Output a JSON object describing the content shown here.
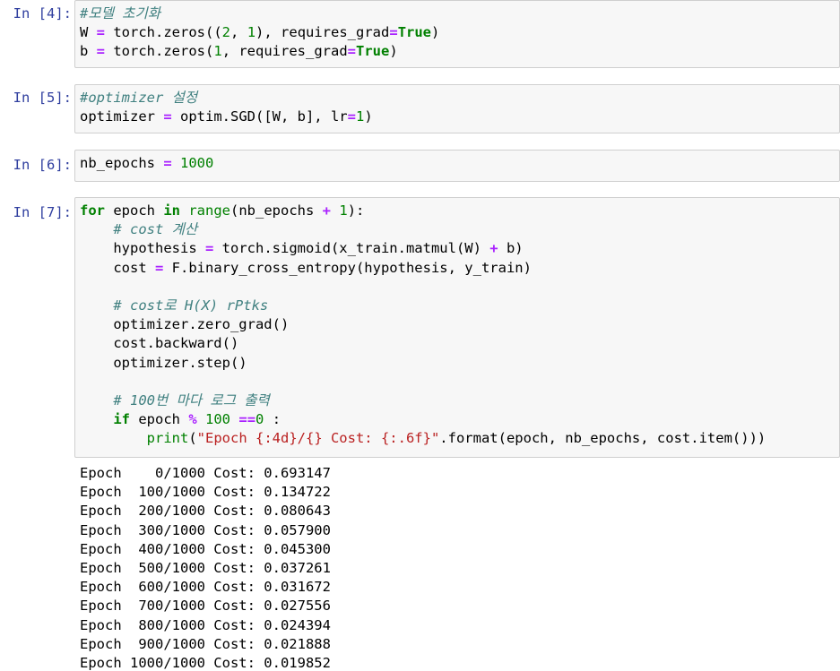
{
  "cells": [
    {
      "prompt": "In [4]:",
      "lines": [
        [
          {
            "t": "#모델 초기화",
            "c": "cm"
          }
        ],
        [
          {
            "t": "W ",
            "c": ""
          },
          {
            "t": "=",
            "c": "op"
          },
          {
            "t": " torch.zeros((",
            "c": ""
          },
          {
            "t": "2",
            "c": "num"
          },
          {
            "t": ", ",
            "c": ""
          },
          {
            "t": "1",
            "c": "num"
          },
          {
            "t": "), requires_grad",
            "c": ""
          },
          {
            "t": "=",
            "c": "op"
          },
          {
            "t": "True",
            "c": "kw"
          },
          {
            "t": ")",
            "c": ""
          }
        ],
        [
          {
            "t": "b ",
            "c": ""
          },
          {
            "t": "=",
            "c": "op"
          },
          {
            "t": " torch.zeros(",
            "c": ""
          },
          {
            "t": "1",
            "c": "num"
          },
          {
            "t": ", requires_grad",
            "c": ""
          },
          {
            "t": "=",
            "c": "op"
          },
          {
            "t": "True",
            "c": "kw"
          },
          {
            "t": ")",
            "c": ""
          }
        ]
      ]
    },
    {
      "prompt": "In [5]:",
      "lines": [
        [
          {
            "t": "#optimizer 설정",
            "c": "cm"
          }
        ],
        [
          {
            "t": "optimizer ",
            "c": ""
          },
          {
            "t": "=",
            "c": "op"
          },
          {
            "t": " optim.SGD([W, b], lr",
            "c": ""
          },
          {
            "t": "=",
            "c": "op"
          },
          {
            "t": "1",
            "c": "num"
          },
          {
            "t": ")",
            "c": ""
          }
        ]
      ]
    },
    {
      "prompt": "In [6]:",
      "lines": [
        [
          {
            "t": "nb_epochs ",
            "c": ""
          },
          {
            "t": "=",
            "c": "op"
          },
          {
            "t": " ",
            "c": ""
          },
          {
            "t": "1000",
            "c": "num"
          }
        ]
      ]
    },
    {
      "prompt": "In [7]:",
      "lines": [
        [
          {
            "t": "for",
            "c": "kw"
          },
          {
            "t": " epoch ",
            "c": ""
          },
          {
            "t": "in",
            "c": "kw"
          },
          {
            "t": " ",
            "c": ""
          },
          {
            "t": "range",
            "c": "bi"
          },
          {
            "t": "(nb_epochs ",
            "c": ""
          },
          {
            "t": "+",
            "c": "op"
          },
          {
            "t": " ",
            "c": ""
          },
          {
            "t": "1",
            "c": "num"
          },
          {
            "t": "):",
            "c": ""
          }
        ],
        [
          {
            "t": "    ",
            "c": ""
          },
          {
            "t": "# cost 계산",
            "c": "cm"
          }
        ],
        [
          {
            "t": "    hypothesis ",
            "c": ""
          },
          {
            "t": "=",
            "c": "op"
          },
          {
            "t": " torch.sigmoid(x_train.matmul(W) ",
            "c": ""
          },
          {
            "t": "+",
            "c": "op"
          },
          {
            "t": " b)",
            "c": ""
          }
        ],
        [
          {
            "t": "    cost ",
            "c": ""
          },
          {
            "t": "=",
            "c": "op"
          },
          {
            "t": " F.binary_cross_entropy(hypothesis, y_train)",
            "c": ""
          }
        ],
        [
          {
            "t": "",
            "c": ""
          }
        ],
        [
          {
            "t": "    ",
            "c": ""
          },
          {
            "t": "# cost로 H(X) rPtks",
            "c": "cm"
          }
        ],
        [
          {
            "t": "    optimizer.zero_grad()",
            "c": ""
          }
        ],
        [
          {
            "t": "    cost.backward()",
            "c": ""
          }
        ],
        [
          {
            "t": "    optimizer.step()",
            "c": ""
          }
        ],
        [
          {
            "t": "",
            "c": ""
          }
        ],
        [
          {
            "t": "    ",
            "c": ""
          },
          {
            "t": "# 100번 마다 로그 출력",
            "c": "cm"
          }
        ],
        [
          {
            "t": "    ",
            "c": ""
          },
          {
            "t": "if",
            "c": "kw"
          },
          {
            "t": " epoch ",
            "c": ""
          },
          {
            "t": "%",
            "c": "op"
          },
          {
            "t": " ",
            "c": ""
          },
          {
            "t": "100",
            "c": "num"
          },
          {
            "t": " ",
            "c": ""
          },
          {
            "t": "==",
            "c": "op"
          },
          {
            "t": "0",
            "c": "num"
          },
          {
            "t": " :",
            "c": ""
          }
        ],
        [
          {
            "t": "        ",
            "c": ""
          },
          {
            "t": "print",
            "c": "bi"
          },
          {
            "t": "(",
            "c": ""
          },
          {
            "t": "\"Epoch {:4d}/{} Cost: {:.6f}\"",
            "c": "str"
          },
          {
            "t": ".format(epoch, nb_epochs, cost.item()))",
            "c": ""
          }
        ]
      ],
      "output": [
        "Epoch    0/1000 Cost: 0.693147",
        "Epoch  100/1000 Cost: 0.134722",
        "Epoch  200/1000 Cost: 0.080643",
        "Epoch  300/1000 Cost: 0.057900",
        "Epoch  400/1000 Cost: 0.045300",
        "Epoch  500/1000 Cost: 0.037261",
        "Epoch  600/1000 Cost: 0.031672",
        "Epoch  700/1000 Cost: 0.027556",
        "Epoch  800/1000 Cost: 0.024394",
        "Epoch  900/1000 Cost: 0.021888",
        "Epoch 1000/1000 Cost: 0.019852"
      ]
    }
  ]
}
